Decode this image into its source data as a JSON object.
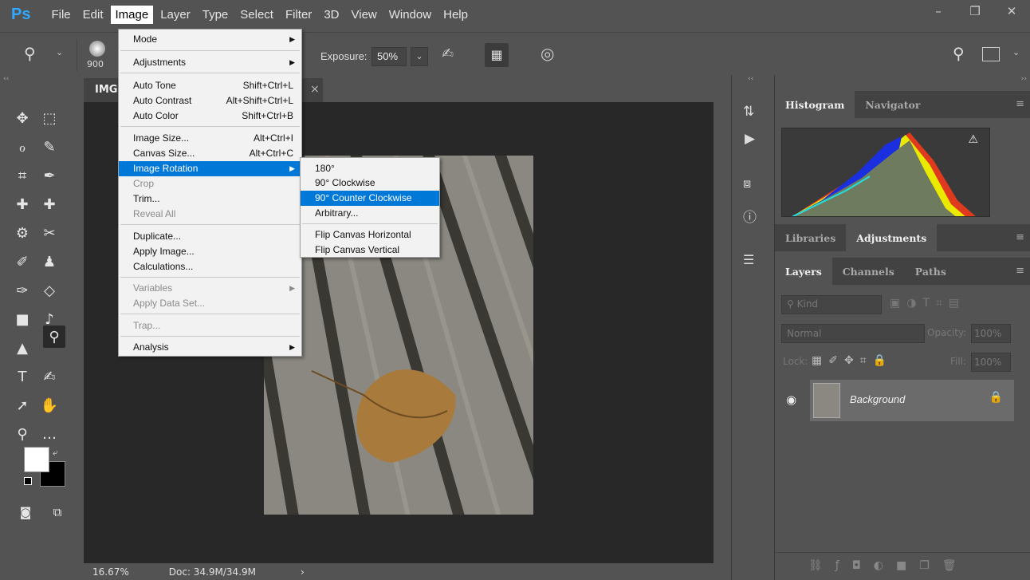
{
  "app": {
    "logo": "Ps"
  },
  "menubar": {
    "items": [
      "File",
      "Edit",
      "Image",
      "Layer",
      "Type",
      "Select",
      "Filter",
      "3D",
      "View",
      "Window",
      "Help"
    ],
    "active": "Image"
  },
  "window_controls": {
    "minimize": "–",
    "restore": "❐",
    "close": "✕"
  },
  "options": {
    "brush_size": "900",
    "exposure_label": "Exposure:",
    "exposure_value": "50%"
  },
  "doc_tab": {
    "title": "IMG",
    "close": "×"
  },
  "image_menu": {
    "items": [
      {
        "label": "Mode",
        "shortcut": "",
        "submenu": true,
        "disabled": false
      },
      {
        "label": "Adjustments",
        "shortcut": "",
        "submenu": true,
        "disabled": false
      },
      {
        "label": "Auto Tone",
        "shortcut": "Shift+Ctrl+L",
        "submenu": false,
        "disabled": false
      },
      {
        "label": "Auto Contrast",
        "shortcut": "Alt+Shift+Ctrl+L",
        "submenu": false,
        "disabled": false
      },
      {
        "label": "Auto Color",
        "shortcut": "Shift+Ctrl+B",
        "submenu": false,
        "disabled": false
      },
      {
        "label": "Image Size...",
        "shortcut": "Alt+Ctrl+I",
        "submenu": false,
        "disabled": false
      },
      {
        "label": "Canvas Size...",
        "shortcut": "Alt+Ctrl+C",
        "submenu": false,
        "disabled": false
      },
      {
        "label": "Image Rotation",
        "shortcut": "",
        "submenu": true,
        "disabled": false,
        "highlighted": true
      },
      {
        "label": "Crop",
        "shortcut": "",
        "submenu": false,
        "disabled": true
      },
      {
        "label": "Trim...",
        "shortcut": "",
        "submenu": false,
        "disabled": false
      },
      {
        "label": "Reveal All",
        "shortcut": "",
        "submenu": false,
        "disabled": true
      },
      {
        "label": "Duplicate...",
        "shortcut": "",
        "submenu": false,
        "disabled": false
      },
      {
        "label": "Apply Image...",
        "shortcut": "",
        "submenu": false,
        "disabled": false
      },
      {
        "label": "Calculations...",
        "shortcut": "",
        "submenu": false,
        "disabled": false
      },
      {
        "label": "Variables",
        "shortcut": "",
        "submenu": true,
        "disabled": true
      },
      {
        "label": "Apply Data Set...",
        "shortcut": "",
        "submenu": false,
        "disabled": true
      },
      {
        "label": "Trap...",
        "shortcut": "",
        "submenu": false,
        "disabled": true
      },
      {
        "label": "Analysis",
        "shortcut": "",
        "submenu": true,
        "disabled": false
      }
    ]
  },
  "rotation_menu": {
    "items": [
      {
        "label": "180°",
        "highlighted": false
      },
      {
        "label": "90° Clockwise",
        "highlighted": false
      },
      {
        "label": "90° Counter Clockwise",
        "highlighted": true
      },
      {
        "label": "Arbitrary...",
        "highlighted": false
      },
      {
        "label": "Flip Canvas Horizontal",
        "highlighted": false
      },
      {
        "label": "Flip Canvas Vertical",
        "highlighted": false
      }
    ]
  },
  "status": {
    "zoom": "16.67%",
    "doc": "Doc: 34.9M/34.9M",
    "arrow": "›"
  },
  "panels": {
    "top_tabs": [
      "Histogram",
      "Navigator"
    ],
    "mid_tabs": [
      "Libraries",
      "Adjustments"
    ],
    "layer_tabs": [
      "Layers",
      "Channels",
      "Paths"
    ],
    "kind_label": "Kind",
    "blend_mode": "Normal",
    "opacity_label": "Opacity:",
    "opacity_value": "100%",
    "lock_label": "Lock:",
    "fill_label": "Fill:",
    "fill_value": "100%",
    "layer_name": "Background"
  },
  "colors": {
    "accent": "#0078d7",
    "ps_blue": "#31a8ff"
  }
}
